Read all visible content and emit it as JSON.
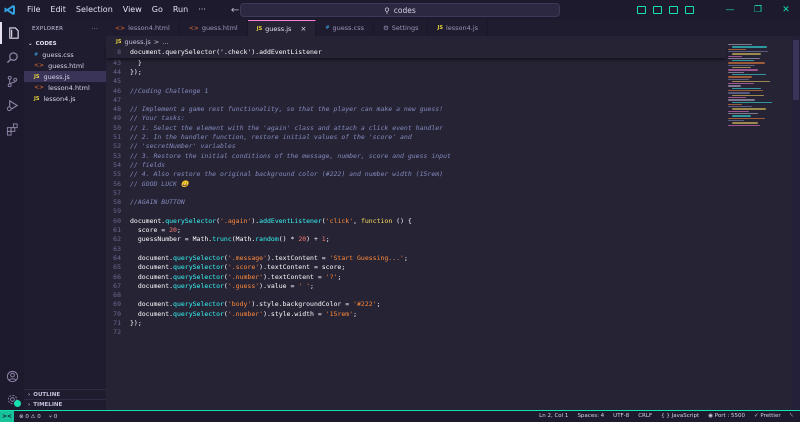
{
  "menu": [
    "File",
    "Edit",
    "Selection",
    "View",
    "Go",
    "Run",
    "···"
  ],
  "command_center": "codes",
  "colors": {
    "accent": "#17e0b0",
    "background": "#262335",
    "sidebar": "#1f1c30"
  },
  "sidebar": {
    "title": "EXPLORER",
    "more": "···",
    "section": "CODES",
    "files": [
      {
        "badge": "#",
        "name": "guess.css",
        "type": "css"
      },
      {
        "badge": "<>",
        "name": "guess.html",
        "type": "html"
      },
      {
        "badge": "JS",
        "name": "guess.js",
        "type": "js",
        "active": true
      },
      {
        "badge": "<>",
        "name": "lesson4.html",
        "type": "html"
      },
      {
        "badge": "JS",
        "name": "lesson4.js",
        "type": "js"
      }
    ],
    "outline": "OUTLINE",
    "timeline": "TIMELINE"
  },
  "tabs": [
    {
      "badge": "<>",
      "name": "lesson4.html"
    },
    {
      "badge": "<>",
      "name": "guess.html"
    },
    {
      "badge": "JS",
      "name": "guess.js",
      "active": true,
      "close": "×"
    },
    {
      "badge": "#",
      "name": "guess.css"
    },
    {
      "badge": "⚙",
      "name": "Settings"
    },
    {
      "badge": "JS",
      "name": "lesson4.js"
    }
  ],
  "breadcrumb": {
    "badge": "JS",
    "file": "guess.js",
    "sep": ">",
    "rest": "..."
  },
  "sticky": {
    "num": "8",
    "text": "document.querySelector('.check').addEventListener"
  },
  "code_lines": [
    {
      "num": "43",
      "parts": [
        [
          "plain",
          "  }"
        ]
      ]
    },
    {
      "num": "44",
      "parts": [
        [
          "plain",
          "});"
        ]
      ]
    },
    {
      "num": "45",
      "parts": []
    },
    {
      "num": "46",
      "parts": [
        [
          "com",
          "//Coding Challenge 1"
        ]
      ]
    },
    {
      "num": "47",
      "parts": []
    },
    {
      "num": "48",
      "parts": [
        [
          "com",
          "// Implement a game rest functionality, so that the player can make a new guess!"
        ]
      ]
    },
    {
      "num": "49",
      "parts": [
        [
          "com",
          "// Your tasks:"
        ]
      ]
    },
    {
      "num": "50",
      "parts": [
        [
          "com",
          "// 1. Select the element with the 'again' class and attach a click event handler"
        ]
      ]
    },
    {
      "num": "51",
      "parts": [
        [
          "com",
          "// 2. In the handler function, restore initial values of the 'score' and"
        ]
      ]
    },
    {
      "num": "52",
      "parts": [
        [
          "com",
          "// 'secretNumber' variables"
        ]
      ]
    },
    {
      "num": "53",
      "parts": [
        [
          "com",
          "// 3. Restore the initial conditions of the message, number, score and guess input"
        ]
      ]
    },
    {
      "num": "54",
      "parts": [
        [
          "com",
          "// fields"
        ]
      ]
    },
    {
      "num": "55",
      "parts": [
        [
          "com",
          "// 4. Also restore the original background color (#222) and number width (15rem)"
        ]
      ]
    },
    {
      "num": "56",
      "parts": [
        [
          "com",
          "// GOOD LUCK 😀"
        ]
      ]
    },
    {
      "num": "57",
      "parts": []
    },
    {
      "num": "58",
      "parts": [
        [
          "com",
          "//AGAIN BUTTON"
        ]
      ]
    },
    {
      "num": "59",
      "parts": []
    },
    {
      "num": "60",
      "parts": [
        [
          "plain",
          "document."
        ],
        [
          "fn",
          "querySelector"
        ],
        [
          "plain",
          "("
        ],
        [
          "str",
          "'.again'"
        ],
        [
          "plain",
          ")."
        ],
        [
          "fn",
          "addEventListener"
        ],
        [
          "plain",
          "("
        ],
        [
          "str",
          "'click'"
        ],
        [
          "plain",
          ", "
        ],
        [
          "kw",
          "function"
        ],
        [
          "plain",
          " () {"
        ]
      ]
    },
    {
      "num": "61",
      "parts": [
        [
          "plain",
          "  score = "
        ],
        [
          "num",
          "20"
        ],
        [
          "plain",
          ";"
        ]
      ]
    },
    {
      "num": "62",
      "parts": [
        [
          "plain",
          "  guessNumber = Math."
        ],
        [
          "fn",
          "trunc"
        ],
        [
          "plain",
          "(Math."
        ],
        [
          "fn",
          "random"
        ],
        [
          "plain",
          "() * "
        ],
        [
          "num",
          "20"
        ],
        [
          "plain",
          ") + "
        ],
        [
          "num",
          "1"
        ],
        [
          "plain",
          ";"
        ]
      ]
    },
    {
      "num": "63",
      "parts": []
    },
    {
      "num": "64",
      "parts": [
        [
          "plain",
          "  document."
        ],
        [
          "fn",
          "querySelector"
        ],
        [
          "plain",
          "("
        ],
        [
          "str",
          "'.message'"
        ],
        [
          "plain",
          ").textContent = "
        ],
        [
          "str",
          "'Start Guessing...'"
        ],
        [
          "plain",
          ";"
        ]
      ]
    },
    {
      "num": "65",
      "parts": [
        [
          "plain",
          "  document."
        ],
        [
          "fn",
          "querySelector"
        ],
        [
          "plain",
          "("
        ],
        [
          "str",
          "'.score'"
        ],
        [
          "plain",
          ").textContent = score;"
        ]
      ]
    },
    {
      "num": "66",
      "parts": [
        [
          "plain",
          "  document."
        ],
        [
          "fn",
          "querySelector"
        ],
        [
          "plain",
          "("
        ],
        [
          "str",
          "'.number'"
        ],
        [
          "plain",
          ").textContent = "
        ],
        [
          "str",
          "'?'"
        ],
        [
          "plain",
          ";"
        ]
      ]
    },
    {
      "num": "67",
      "parts": [
        [
          "plain",
          "  document."
        ],
        [
          "fn",
          "querySelector"
        ],
        [
          "plain",
          "("
        ],
        [
          "str",
          "'.guess'"
        ],
        [
          "plain",
          ").value = "
        ],
        [
          "str",
          "' '"
        ],
        [
          "plain",
          ";"
        ]
      ]
    },
    {
      "num": "68",
      "parts": []
    },
    {
      "num": "69",
      "parts": [
        [
          "plain",
          "  document."
        ],
        [
          "fn",
          "querySelector"
        ],
        [
          "plain",
          "("
        ],
        [
          "str",
          "'body'"
        ],
        [
          "plain",
          ").style.backgroundColor = "
        ],
        [
          "str",
          "'#222'"
        ],
        [
          "plain",
          ";"
        ]
      ]
    },
    {
      "num": "70",
      "parts": [
        [
          "plain",
          "  document."
        ],
        [
          "fn",
          "querySelector"
        ],
        [
          "plain",
          "("
        ],
        [
          "str",
          "'.number'"
        ],
        [
          "plain",
          ").style.width = "
        ],
        [
          "str",
          "'15rem'"
        ],
        [
          "plain",
          ";"
        ]
      ]
    },
    {
      "num": "71",
      "parts": [
        [
          "plain",
          "});"
        ]
      ]
    },
    {
      "num": "72",
      "parts": []
    }
  ],
  "status": {
    "remote": "><",
    "problems": "⊗ 0 ⚠ 0",
    "ports": "⑂ 0",
    "position": "Ln 2, Col 1",
    "spaces": "Spaces: 4",
    "encoding": "UTF-8",
    "eol": "CRLF",
    "language": "{ } JavaScript",
    "port": "◉ Port : 5500",
    "prettier": "✓ Prettier",
    "bell": "␇"
  }
}
